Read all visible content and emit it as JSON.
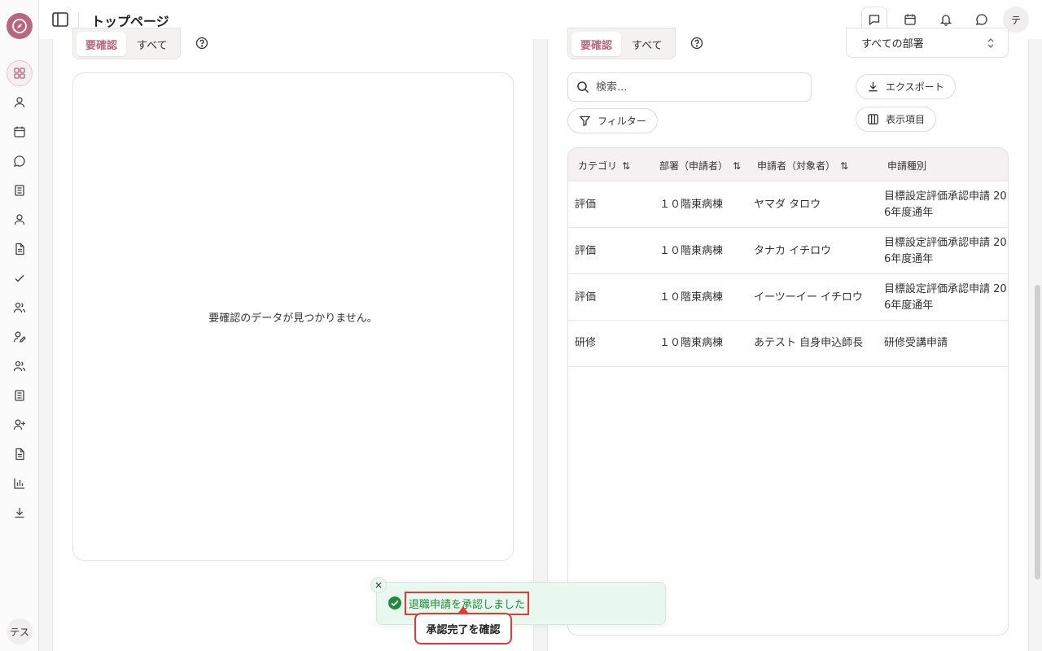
{
  "header": {
    "title": "トップページ",
    "user_initial": "テ"
  },
  "sidebar": {
    "bottom_avatar": "テス"
  },
  "left_panel": {
    "tabs": [
      "要確認",
      "すべて"
    ],
    "empty_message": "要確認のデータが見つかりません。"
  },
  "right_panel": {
    "tabs": [
      "要確認",
      "すべて"
    ],
    "department_select": "すべての部署",
    "search_placeholder": "検索...",
    "export_label": "エクスポート",
    "filter_label": "フィルター",
    "columns_label": "表示項目",
    "table": {
      "headers": [
        "カテゴリ",
        "部署（申請者）",
        "申請者（対象者）",
        "申請種別"
      ],
      "rows": [
        [
          "評価",
          "１０階東病棟",
          "ヤマダ タロウ",
          "目標設定評価承認申請 20",
          "6年度通年"
        ],
        [
          "評価",
          "１０階東病棟",
          "タナカ イチロウ",
          "目標設定評価承認申請 20",
          "6年度通年"
        ],
        [
          "評価",
          "１０階東病棟",
          "イーツーイー イチロウ",
          "目標設定評価承認申請 20",
          "6年度通年"
        ],
        [
          "研修",
          "１０階東病棟",
          "あテスト 自身申込師長",
          "研修受講申請",
          ""
        ]
      ]
    }
  },
  "toast": {
    "message": "退職申請を承認しました",
    "confirm_label": "承認完了を確認"
  },
  "colors": {
    "accent": "#b8677f",
    "success": "#1f8a3a",
    "highlight": "#e53935"
  }
}
